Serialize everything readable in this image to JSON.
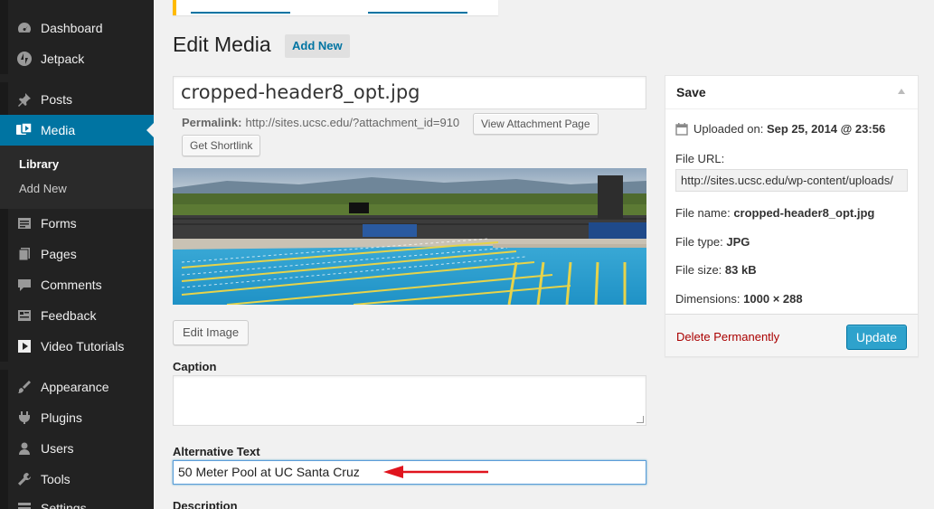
{
  "sidebar": {
    "items": [
      {
        "label": "Dashboard",
        "icon": "dashboard-icon"
      },
      {
        "label": "Jetpack",
        "icon": "jetpack-icon"
      },
      {
        "label": "Posts",
        "icon": "pin-icon"
      },
      {
        "label": "Media",
        "icon": "media-icon"
      },
      {
        "label": "Forms",
        "icon": "forms-icon"
      },
      {
        "label": "Pages",
        "icon": "pages-icon"
      },
      {
        "label": "Comments",
        "icon": "comments-icon"
      },
      {
        "label": "Feedback",
        "icon": "feedback-icon"
      },
      {
        "label": "Video Tutorials",
        "icon": "video-icon"
      },
      {
        "label": "Appearance",
        "icon": "brush-icon"
      },
      {
        "label": "Plugins",
        "icon": "plugin-icon"
      },
      {
        "label": "Users",
        "icon": "users-icon"
      },
      {
        "label": "Tools",
        "icon": "wrench-icon"
      },
      {
        "label": "Settings",
        "icon": "settings-icon"
      }
    ],
    "media_sub": [
      {
        "label": "Library"
      },
      {
        "label": "Add New"
      }
    ]
  },
  "header": {
    "title": "Edit Media",
    "add_new": "Add New"
  },
  "edit": {
    "title_value": "cropped-header8_opt.jpg",
    "permalink_label": "Permalink:",
    "permalink_url": "http://sites.ucsc.edu/?attachment_id=910",
    "view_attachment": "View Attachment Page",
    "get_shortlink": "Get Shortlink",
    "edit_image": "Edit Image",
    "caption_label": "Caption",
    "caption_value": "",
    "alt_label": "Alternative Text",
    "alt_value": "50 Meter Pool at UC Santa Cruz",
    "description_label": "Description"
  },
  "save_box": {
    "title": "Save",
    "uploaded_label": "Uploaded on:",
    "uploaded_value": "Sep 25, 2014 @ 23:56",
    "file_url_label": "File URL:",
    "file_url_value": "http://sites.ucsc.edu/wp-content/uploads/",
    "file_name_label": "File name:",
    "file_name_value": "cropped-header8_opt.jpg",
    "file_type_label": "File type:",
    "file_type_value": "JPG",
    "file_size_label": "File size:",
    "file_size_value": "83 kB",
    "dimensions_label": "Dimensions:",
    "dimensions_value": "1000 × 288",
    "delete_label": "Delete Permanently",
    "update_label": "Update"
  },
  "colors": {
    "accent": "#0074a2",
    "sidebar_bg": "#222222",
    "update_button": "#2ea2cc",
    "delete_link": "#aa0000",
    "annotation_arrow": "#e0141e"
  }
}
